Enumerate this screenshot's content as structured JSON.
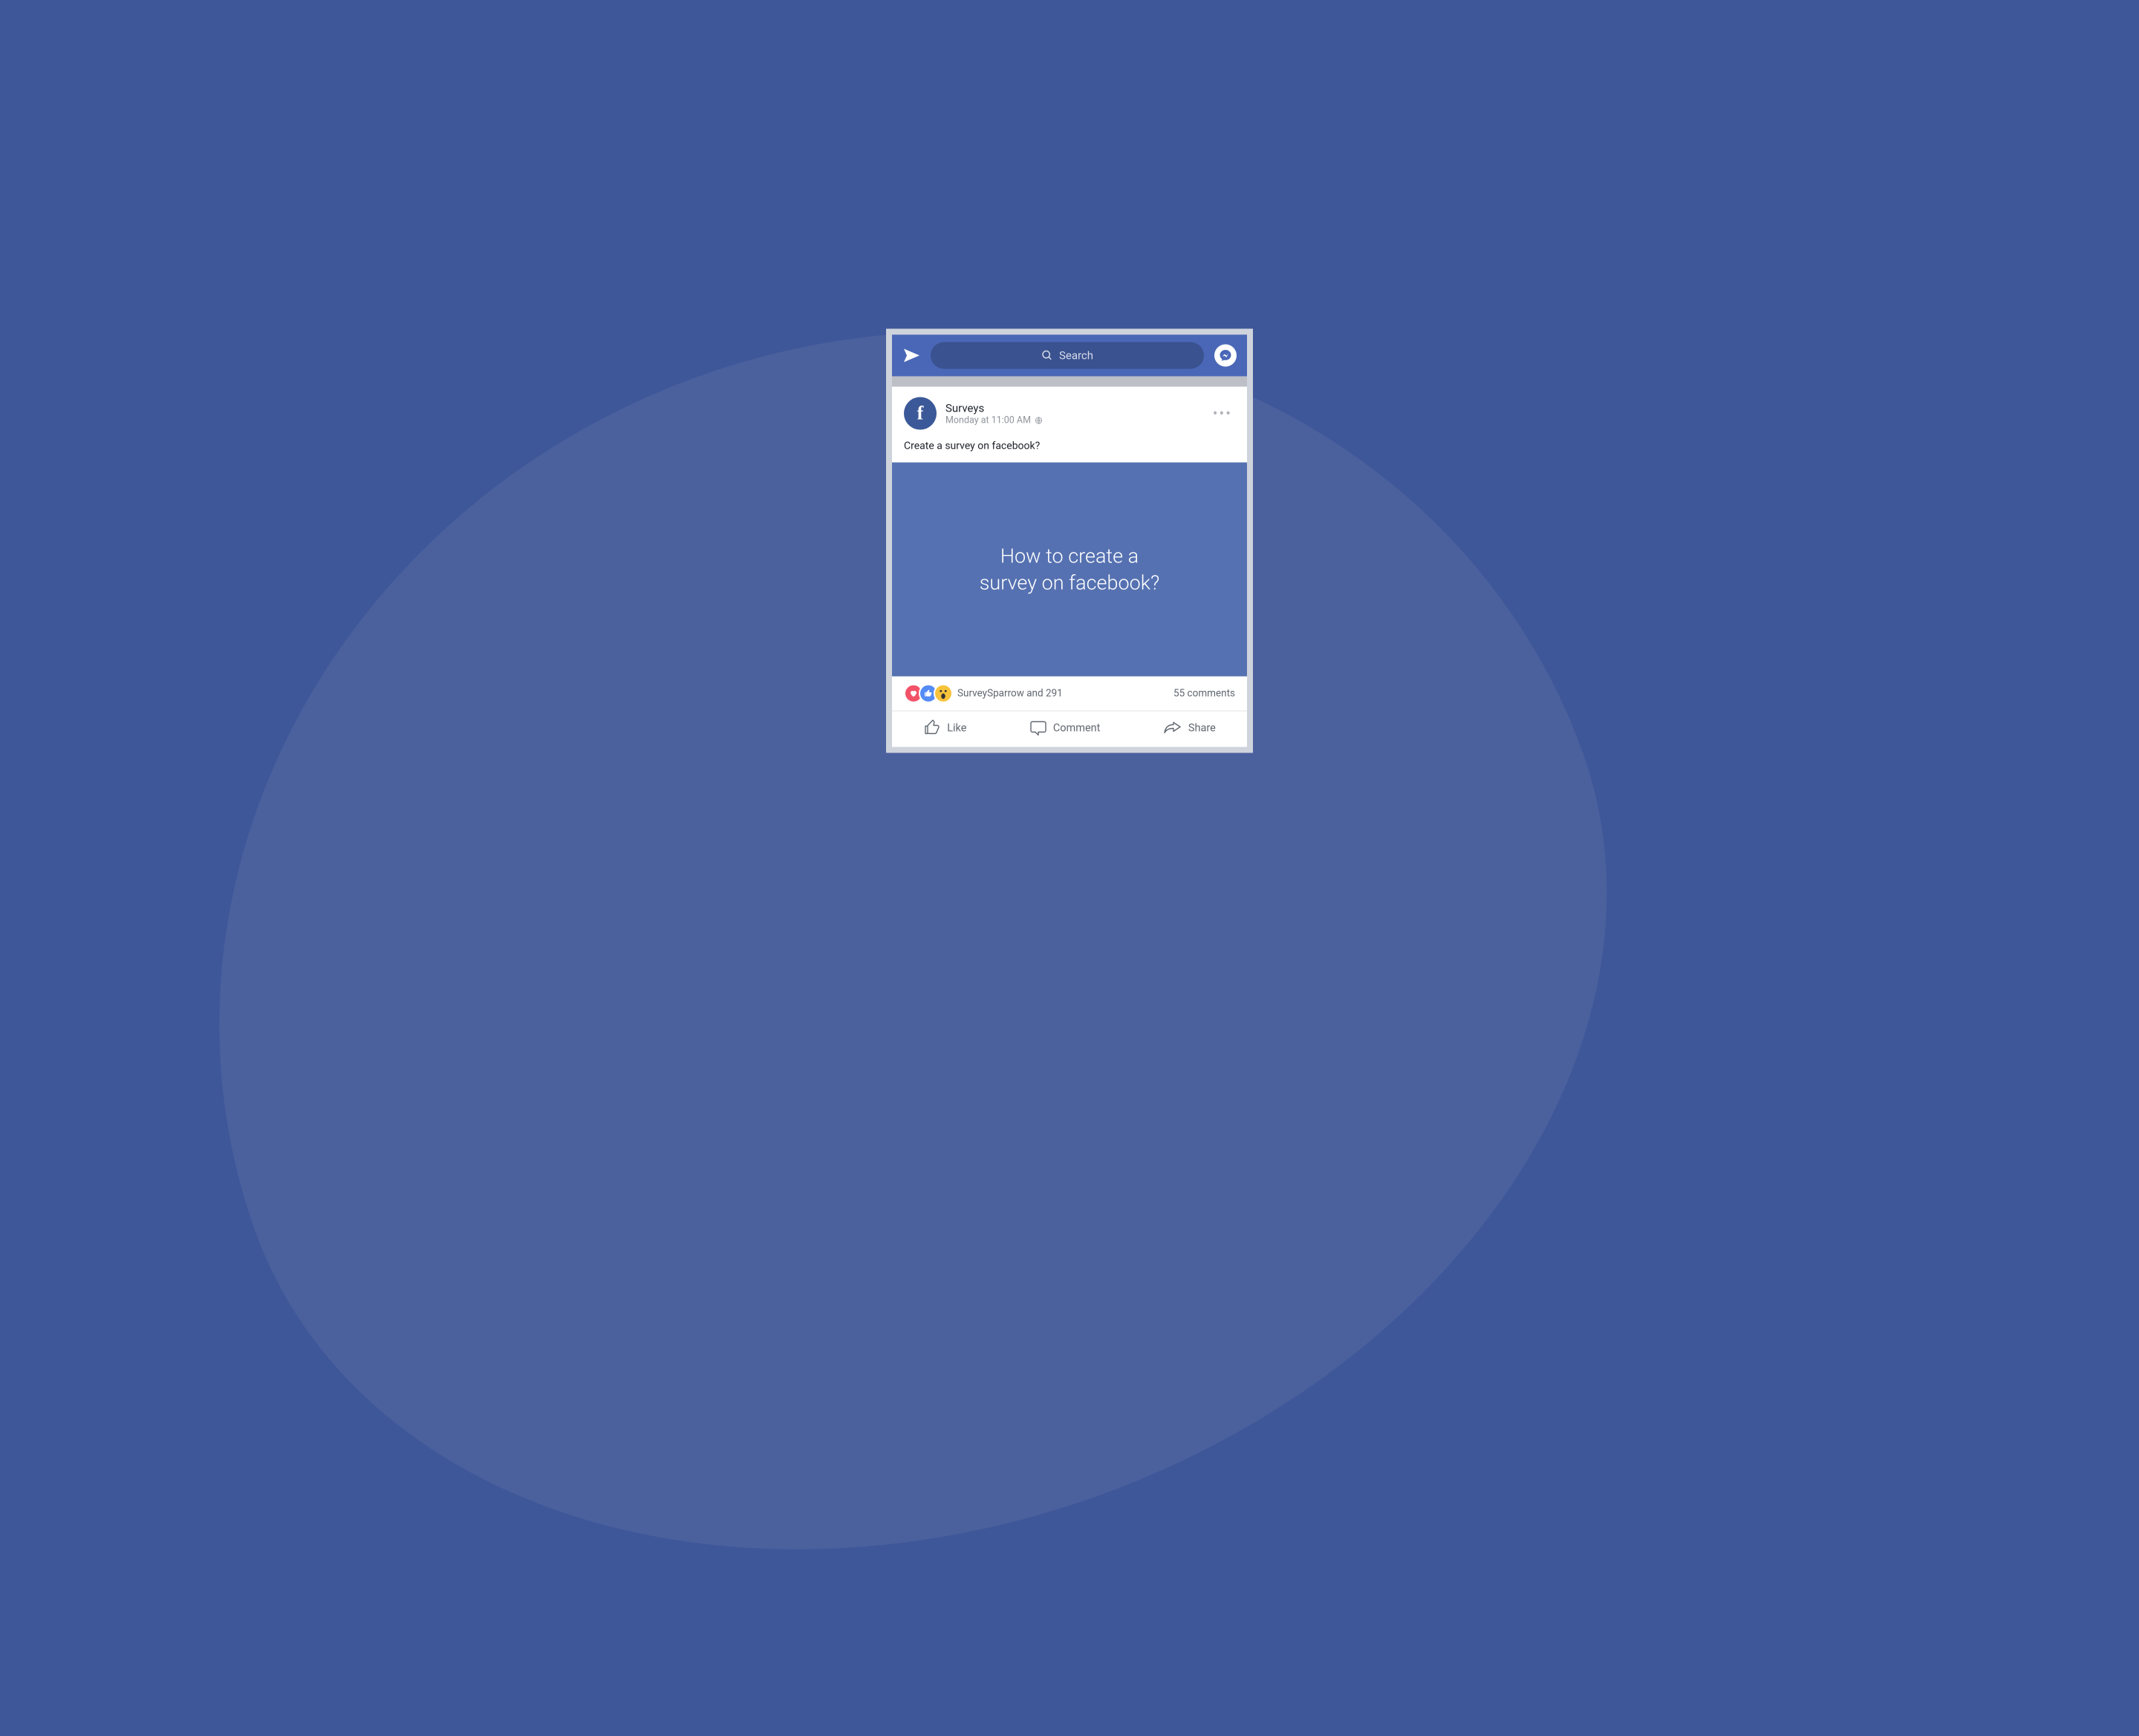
{
  "colors": {
    "page_bg": "#3e5799",
    "bubble": "#4b619e",
    "bar": "#4a67b7",
    "search_pill": "#3a528f",
    "media": "#5571b1"
  },
  "topbar": {
    "search_placeholder": "Search"
  },
  "post": {
    "author": "Surveys",
    "timestamp": "Monday at 11:00 AM",
    "body": "Create a survey on facebook?",
    "media_text": "How to create a\nsurvey on facebook?",
    "reactions_text": "SurveySparrow and  291",
    "comments_text": "55 comments"
  },
  "actions": {
    "like": "Like",
    "comment": "Comment",
    "share": "Share"
  }
}
